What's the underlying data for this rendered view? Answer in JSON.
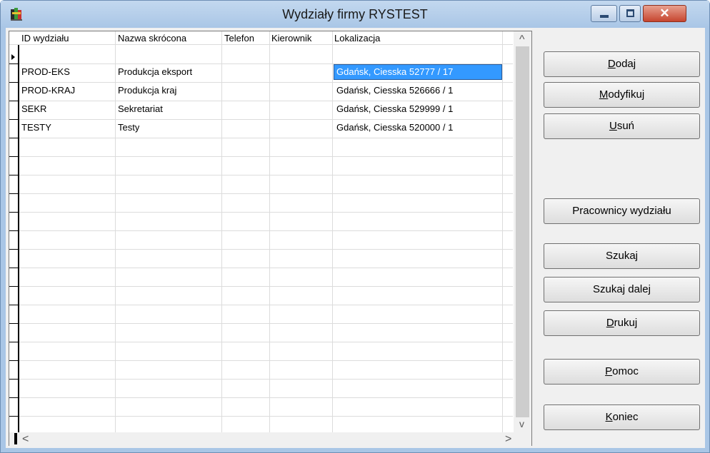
{
  "window": {
    "title": "Wydziały firmy RYSTEST",
    "close_glyph": "✕"
  },
  "grid": {
    "columns": [
      "ID wydziału",
      "Nazwa skrócona",
      "Telefon",
      "Kierownik",
      "Lokalizacja"
    ],
    "rows": [
      {
        "id": "PROD-EKS",
        "name": "Produkcja eksport",
        "phone": "",
        "manager": "",
        "location": "Gdańsk, Ciesska 52777 / 17"
      },
      {
        "id": "PROD-KRAJ",
        "name": "Produkcja kraj",
        "phone": "",
        "manager": "",
        "location": "Gdańsk, Ciesska 526666 / 1"
      },
      {
        "id": "SEKR",
        "name": "Sekretariat",
        "phone": "",
        "manager": "",
        "location": "Gdańsk, Ciesska 529999 / 1"
      },
      {
        "id": "TESTY",
        "name": "Testy",
        "phone": "",
        "manager": "",
        "location": "Gdańsk, Ciesska 520000 / 1"
      }
    ],
    "scroll_up": "^",
    "scroll_down": "v",
    "scroll_left": "<",
    "scroll_right": ">"
  },
  "buttons": {
    "add": {
      "u": "D",
      "rest": "odaj"
    },
    "modify": {
      "u": "M",
      "rest": "odyfikuj"
    },
    "delete": {
      "u": "U",
      "rest": "suń"
    },
    "employees": "Pracownicy wydziału",
    "search": "Szukaj",
    "search_next": "Szukaj dalej",
    "print": {
      "u": "D",
      "rest": "rukuj"
    },
    "help": {
      "u": "P",
      "rest": "omoc"
    },
    "close": {
      "u": "K",
      "rest": "oniec"
    }
  },
  "colors": {
    "selection": "#3399ff",
    "titlebar": "#a9c6e6"
  }
}
